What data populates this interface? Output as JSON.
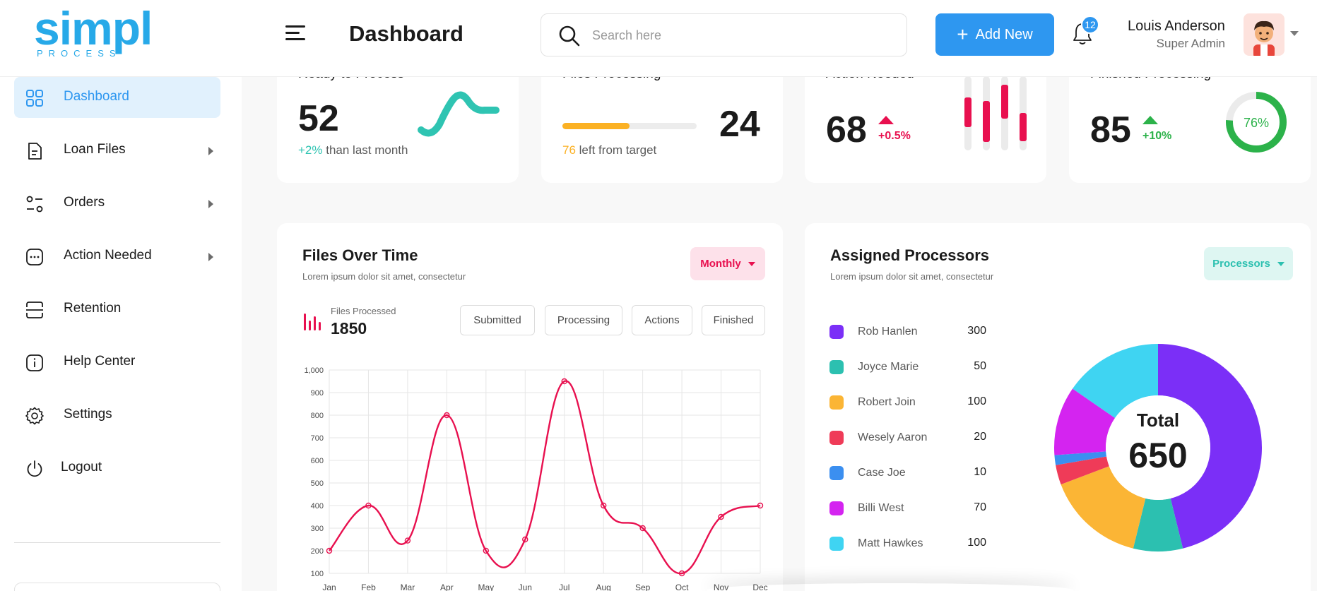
{
  "brand": {
    "logo_text": "simpl",
    "logo_sub": "PROCESS",
    "primary": "#2e97f0",
    "logo_color": "#27a9e8"
  },
  "header": {
    "title": "Dashboard",
    "search_placeholder": "Search here",
    "add_new_label": "Add New",
    "notification_count": "12",
    "user_name": "Louis Anderson",
    "user_role": "Super Admin"
  },
  "sidebar": {
    "items": [
      {
        "label": "Dashboard",
        "icon": "grid-icon",
        "active": true
      },
      {
        "label": "Loan Files",
        "icon": "file-icon",
        "has_submenu": true
      },
      {
        "label": "Orders",
        "icon": "sliders-icon",
        "has_submenu": true
      },
      {
        "label": "Action Needed",
        "icon": "chat-dots-icon",
        "has_submenu": true
      },
      {
        "label": "Retention",
        "icon": "scan-icon"
      },
      {
        "label": "Help Center",
        "icon": "info-icon"
      },
      {
        "label": "Settings",
        "icon": "gear-icon"
      },
      {
        "label": "Logout",
        "icon": "power-icon"
      }
    ]
  },
  "stats": {
    "ready": {
      "title": "Ready to Process",
      "value": "52",
      "change": "+2%",
      "change_text": "than last month",
      "color": "#2fc4b2"
    },
    "processing": {
      "title": "Files Processing",
      "value": "24",
      "remaining": "76",
      "remaining_text": "left from target",
      "progress": 0.5,
      "color": "#fbb124"
    },
    "action": {
      "title": "Action Needed",
      "value": "68",
      "change": "+0.5%",
      "color": "#e8104f"
    },
    "finished": {
      "title": "Finished Processing",
      "value": "85",
      "change": "+10%",
      "ring_label": "76%",
      "ring_value": 0.76,
      "color": "#2cb24a"
    }
  },
  "files_over_time": {
    "title": "Files Over Time",
    "subtitle": "Lorem ipsum dolor sit amet, consectetur",
    "period_label": "Monthly",
    "metric_label": "Files Processed",
    "metric_value": "1850",
    "filters": [
      "Submitted",
      "Processing",
      "Actions",
      "Finished"
    ]
  },
  "processors": {
    "title": "Assigned Processors",
    "subtitle": "Lorem ipsum dolor sit amet, consectetur",
    "dropdown_label": "Processors",
    "total_label": "Total",
    "total_value": "650",
    "items": [
      {
        "name": "Rob Hanlen",
        "value": "300",
        "color": "#7b2ff7"
      },
      {
        "name": "Joyce Marie",
        "value": "50",
        "color": "#2cc0b0"
      },
      {
        "name": "Robert Join",
        "value": "100",
        "color": "#fbb535"
      },
      {
        "name": "Wesely Aaron",
        "value": "20",
        "color": "#ef3b58"
      },
      {
        "name": "Case Joe",
        "value": "10",
        "color": "#3b8ff0"
      },
      {
        "name": "Billi West",
        "value": "70",
        "color": "#d424f0"
      },
      {
        "name": "Matt Hawkes",
        "value": "100",
        "color": "#3fd4f2"
      }
    ]
  },
  "chart_data": [
    {
      "type": "line",
      "categories": [
        "Jan",
        "Feb",
        "Mar",
        "Apr",
        "May",
        "Jun",
        "Jul",
        "Aug",
        "Sep",
        "Oct",
        "Nov",
        "Dec"
      ],
      "values": [
        200,
        400,
        245,
        800,
        200,
        250,
        950,
        400,
        300,
        100,
        350,
        400
      ],
      "ylim": [
        100,
        1000
      ],
      "yticks": [
        "100",
        "200",
        "300",
        "400",
        "500",
        "600",
        "700",
        "800",
        "900",
        "1,000"
      ],
      "grid": true,
      "color": "#e8104f"
    },
    {
      "type": "pie",
      "categories": [
        "Rob Hanlen",
        "Joyce Marie",
        "Robert Join",
        "Wesely Aaron",
        "Case Joe",
        "Billi West",
        "Matt Hawkes"
      ],
      "values": [
        300,
        50,
        100,
        20,
        10,
        70,
        100
      ]
    }
  ]
}
